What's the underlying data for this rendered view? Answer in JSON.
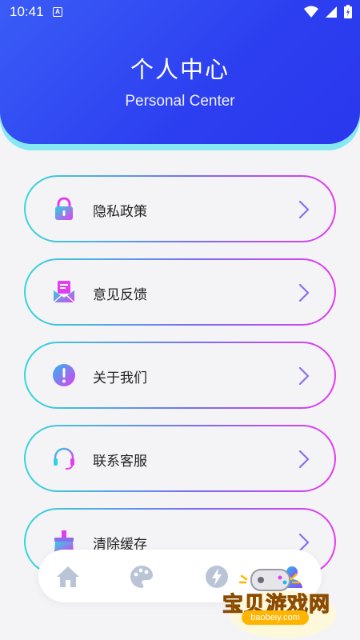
{
  "status_bar": {
    "time": "10:41",
    "notification_icon": "A"
  },
  "header": {
    "title": "个人中心",
    "subtitle": "Personal Center"
  },
  "menu": [
    {
      "label": "隐私政策",
      "icon": "lock-icon"
    },
    {
      "label": "意见反馈",
      "icon": "mail-feedback-icon"
    },
    {
      "label": "关于我们",
      "icon": "info-icon"
    },
    {
      "label": "联系客服",
      "icon": "headset-icon"
    },
    {
      "label": "清除缓存",
      "icon": "brush-icon"
    }
  ],
  "bottom_nav": [
    {
      "name": "home-icon"
    },
    {
      "name": "palette-icon"
    },
    {
      "name": "lightning-icon"
    },
    {
      "name": "profile-icon"
    }
  ],
  "watermark": {
    "text": "宝贝游戏网",
    "url": "baobeiy.com"
  },
  "colors": {
    "header_start": "#3a5cf6",
    "header_end": "#2a37ee",
    "border_start": "#35d8d8",
    "border_end": "#e33cf0"
  }
}
